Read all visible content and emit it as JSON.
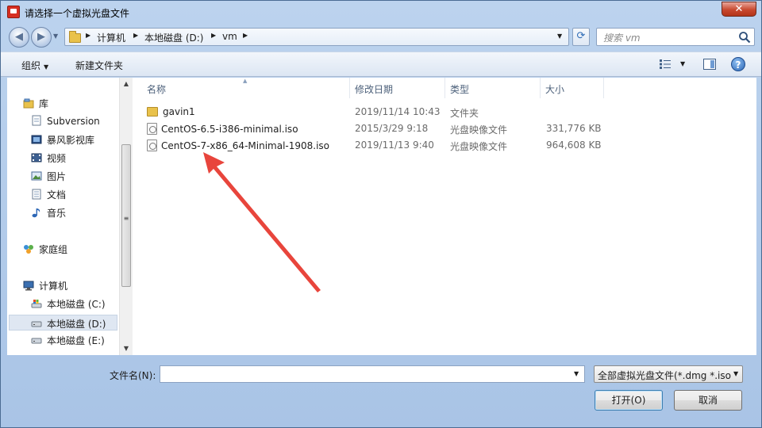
{
  "window": {
    "title": "请选择一个虚拟光盘文件",
    "close_glyph": "✕"
  },
  "nav": {
    "back_glyph": "◀",
    "forward_glyph": "▶",
    "breadcrumbs": [
      "计算机",
      "本地磁盘 (D:)",
      "vm"
    ],
    "search_placeholder": "搜索 vm"
  },
  "toolbar": {
    "organize_label": "组织",
    "new_folder_label": "新建文件夹",
    "help_glyph": "?"
  },
  "sidebar": {
    "items": [
      {
        "label": "库",
        "icon": "library-icon"
      },
      {
        "label": "Subversion",
        "icon": "document-icon"
      },
      {
        "label": "暴风影视库",
        "icon": "media-library-icon"
      },
      {
        "label": "视频",
        "icon": "video-icon"
      },
      {
        "label": "图片",
        "icon": "picture-icon"
      },
      {
        "label": "文档",
        "icon": "document-icon"
      },
      {
        "label": "音乐",
        "icon": "music-icon"
      },
      {
        "label": "家庭组",
        "icon": "homegroup-icon"
      },
      {
        "label": "计算机",
        "icon": "computer-icon"
      },
      {
        "label": "本地磁盘 (C:)",
        "icon": "drive-icon"
      },
      {
        "label": "本地磁盘 (D:)",
        "icon": "drive-icon"
      },
      {
        "label": "本地磁盘 (E:)",
        "icon": "drive-icon"
      }
    ],
    "selected": "本地磁盘 (D:)"
  },
  "file_list": {
    "columns": [
      "名称",
      "修改日期",
      "类型",
      "大小"
    ],
    "rows": [
      {
        "name": "gavin1",
        "date": "2019/11/14 10:43",
        "type": "文件夹",
        "size": "",
        "icon": "folder-icon"
      },
      {
        "name": "CentOS-6.5-i386-minimal.iso",
        "date": "2015/3/29 9:18",
        "type": "光盘映像文件",
        "size": "331,776 KB",
        "icon": "disc-image-icon"
      },
      {
        "name": "CentOS-7-x86_64-Minimal-1908.iso",
        "date": "2019/11/13 9:40",
        "type": "光盘映像文件",
        "size": "964,608 KB",
        "icon": "disc-image-icon"
      }
    ]
  },
  "bottom": {
    "filename_label": "文件名(N):",
    "filename_value": "",
    "filter_value": "全部虚拟光盘文件(*.dmg *.iso",
    "open_label": "打开(O)",
    "cancel_label": "取消"
  },
  "colors": {
    "annotation_arrow": "#e8453c",
    "accent": "#2d67b6"
  }
}
